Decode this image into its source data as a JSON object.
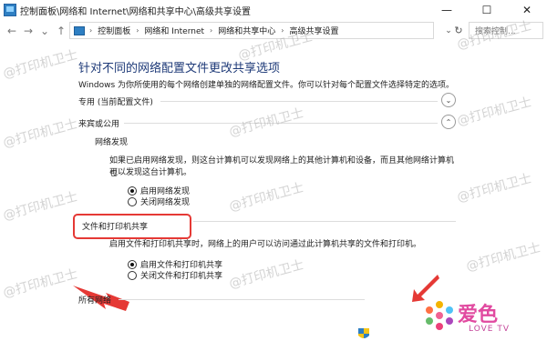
{
  "window": {
    "title": "控制面板\\网络和 Internet\\网络和共享中心\\高级共享设置",
    "controls": {
      "minimize": "—",
      "maximize": "☐",
      "close": "✕"
    }
  },
  "nav": {
    "back": "←",
    "forward": "→",
    "recent": "⌄",
    "up": "↑"
  },
  "address": {
    "crumbs": [
      "控制面板",
      "网络和 Internet",
      "网络和共享中心",
      "高级共享设置"
    ],
    "tail": "⌄",
    "refresh": "↻",
    "search_placeholder": "搜索控制..."
  },
  "content": {
    "title": "针对不同的网络配置文件更改共享选项",
    "description": "Windows 为你所使用的每个网络创建单独的网络配置文件。你可以针对每个配置文件选择特定的选项。",
    "sections": {
      "private": {
        "label": "专用 (当前配置文件)",
        "toggle": "⌄"
      },
      "guest": {
        "label": "来宾或公用",
        "toggle": "⌃"
      },
      "all": {
        "label": "所有网络"
      }
    },
    "network_discovery": {
      "title": "网络发现",
      "desc_line1": "如果已启用网络发现，则这台计算机可以发现网络上的其他计算机和设备，而且其他网络计算机也",
      "desc_line2": "可以发现这台计算机。",
      "on_label": "启用网络发现",
      "off_label": "关闭网络发现"
    },
    "file_sharing": {
      "title": "文件和打印机共享",
      "desc": "启用文件和打印机共享时，网络上的用户可以访问通过此计算机共享的文件和打印机。",
      "on_label": "启用文件和打印机共享",
      "off_label": "关闭文件和打印机共享"
    }
  },
  "watermark": "@打印机卫士",
  "logo": {
    "text": "爱色",
    "sub": "LOVE TV"
  },
  "colors": {
    "title_blue": "#1e3a78",
    "highlight_red": "#e53935",
    "logo_pink": "#e14aa0"
  }
}
